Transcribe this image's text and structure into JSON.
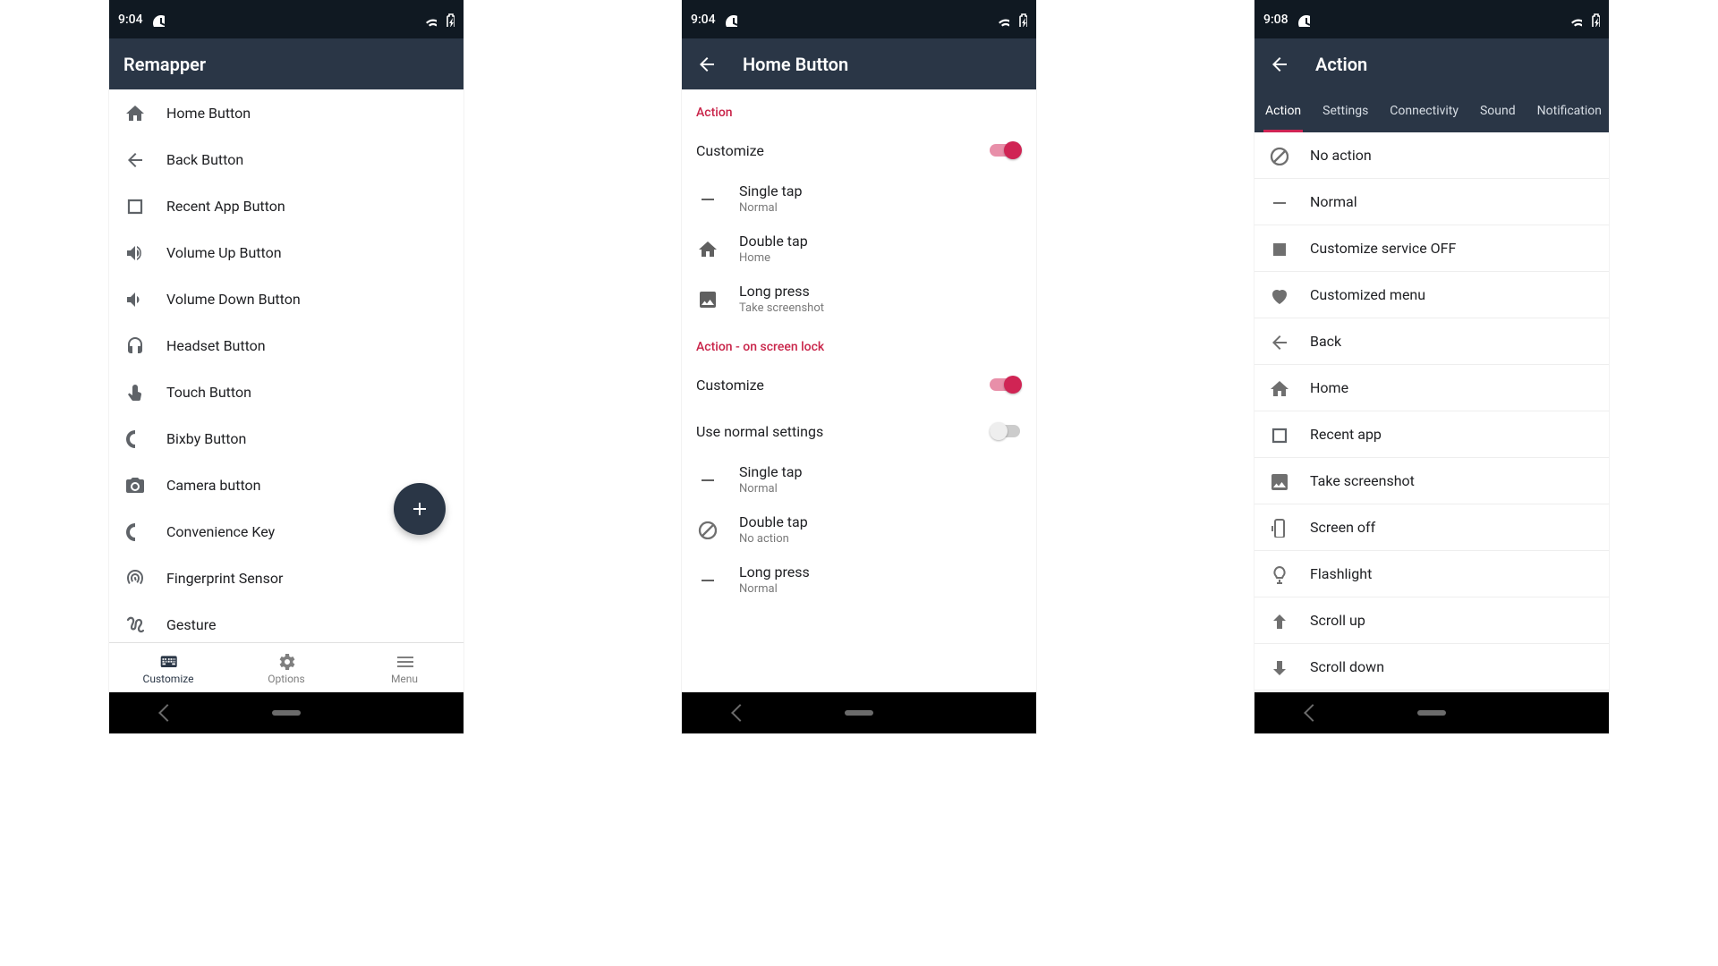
{
  "screen1": {
    "statusbar": {
      "time": "9:04"
    },
    "appbar": {
      "title": "Remapper"
    },
    "items": [
      {
        "label": "Home Button",
        "icon": "home"
      },
      {
        "label": "Back Button",
        "icon": "arrow-back"
      },
      {
        "label": "Recent App Button",
        "icon": "square"
      },
      {
        "label": "Volume Up Button",
        "icon": "volume-up"
      },
      {
        "label": "Volume Down Button",
        "icon": "volume-down"
      },
      {
        "label": "Headset Button",
        "icon": "headset"
      },
      {
        "label": "Touch Button",
        "icon": "touch"
      },
      {
        "label": "Bixby Button",
        "icon": "bixby"
      },
      {
        "label": "Camera button",
        "icon": "camera"
      },
      {
        "label": "Convenience Key",
        "icon": "bixby"
      },
      {
        "label": "Fingerprint Sensor",
        "icon": "fingerprint"
      },
      {
        "label": "Gesture",
        "icon": "gesture"
      }
    ],
    "fab": {
      "icon": "plus"
    },
    "bottomnav": [
      {
        "label": "Customize",
        "icon": "keyboard",
        "active": true
      },
      {
        "label": "Options",
        "icon": "gear",
        "active": false
      },
      {
        "label": "Menu",
        "icon": "menu",
        "active": false
      }
    ]
  },
  "screen2": {
    "statusbar": {
      "time": "9:04"
    },
    "appbar": {
      "title": "Home Button",
      "back": true
    },
    "section1": {
      "header": "Action",
      "customize": {
        "label": "Customize",
        "on": true
      },
      "rows": [
        {
          "title": "Single tap",
          "sub": "Normal",
          "icon": "dash"
        },
        {
          "title": "Double tap",
          "sub": "Home",
          "icon": "home"
        },
        {
          "title": "Long press",
          "sub": "Take screenshot",
          "icon": "image"
        }
      ]
    },
    "section2": {
      "header": "Action - on screen lock",
      "customize": {
        "label": "Customize",
        "on": true
      },
      "use_normal": {
        "label": "Use normal settings",
        "on": false
      },
      "rows": [
        {
          "title": "Single tap",
          "sub": "Normal",
          "icon": "dash"
        },
        {
          "title": "Double tap",
          "sub": "No action",
          "icon": "noaction"
        },
        {
          "title": "Long press",
          "sub": "Normal",
          "icon": "dash"
        }
      ]
    }
  },
  "screen3": {
    "statusbar": {
      "time": "9:08"
    },
    "appbar": {
      "title": "Action",
      "back": true
    },
    "tabs": [
      {
        "label": "Action",
        "active": true
      },
      {
        "label": "Settings"
      },
      {
        "label": "Connectivity"
      },
      {
        "label": "Sound"
      },
      {
        "label": "Notification"
      }
    ],
    "actions": [
      {
        "label": "No action",
        "icon": "noaction"
      },
      {
        "label": "Normal",
        "icon": "dash"
      },
      {
        "label": "Customize service OFF",
        "icon": "stop"
      },
      {
        "label": "Customized menu",
        "icon": "heart"
      },
      {
        "label": "Back",
        "icon": "arrow-back"
      },
      {
        "label": "Home",
        "icon": "home"
      },
      {
        "label": "Recent app",
        "icon": "square"
      },
      {
        "label": "Take screenshot",
        "icon": "image"
      },
      {
        "label": "Screen off",
        "icon": "screenoff"
      },
      {
        "label": "Flashlight",
        "icon": "flashlight"
      },
      {
        "label": "Scroll up",
        "icon": "arrow-up"
      },
      {
        "label": "Scroll down",
        "icon": "arrow-down"
      }
    ]
  }
}
